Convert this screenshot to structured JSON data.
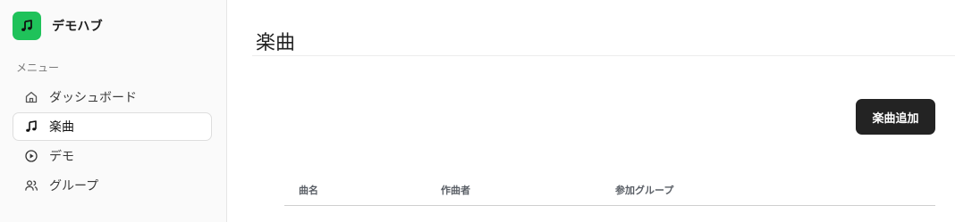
{
  "brand": {
    "name": "デモハブ",
    "logo_icon": "music-note-icon",
    "logo_color": "#1fc25a"
  },
  "sidebar": {
    "section_label": "メニュー",
    "items": [
      {
        "label": "ダッシュボード",
        "icon": "home-icon",
        "active": false
      },
      {
        "label": "楽曲",
        "icon": "music-note-icon",
        "active": true
      },
      {
        "label": "デモ",
        "icon": "play-circle-icon",
        "active": false
      },
      {
        "label": "グループ",
        "icon": "users-icon",
        "active": false
      }
    ]
  },
  "main": {
    "title": "楽曲",
    "add_button_label": "楽曲追加",
    "table": {
      "columns": [
        "曲名",
        "作曲者",
        "参加グループ"
      ],
      "rows": []
    }
  },
  "colors": {
    "accent": "#1fc25a",
    "button_bg": "#232323",
    "sidebar_bg": "#fafafa"
  }
}
